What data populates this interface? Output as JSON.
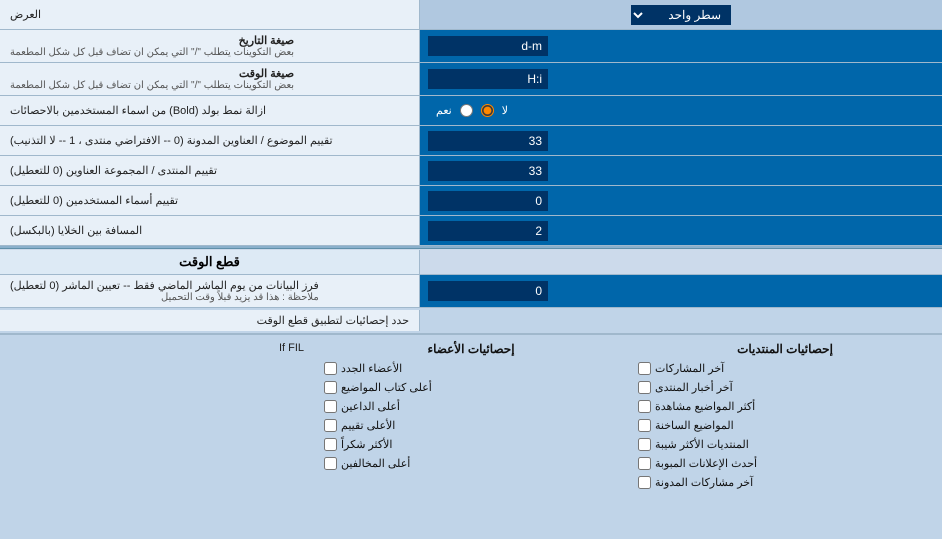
{
  "header": {
    "dropdown_label": "سطر واحد",
    "col_right_label": "العرض"
  },
  "date_format": {
    "label": "صيغة التاريخ",
    "sublabel": "بعض التكوينات يتطلب \"/\" التي يمكن ان تضاف قبل كل شكل المطعمة",
    "value": "d-m"
  },
  "time_format": {
    "label": "صيغة الوقت",
    "sublabel": "بعض التكوينات يتطلب \"/\" التي يمكن ان تضاف قبل كل شكل المطعمة",
    "value": "H:i"
  },
  "bold_remove": {
    "label": "ازالة نمط بولد (Bold) من اسماء المستخدمين بالاحصائات",
    "option_yes": "نعم",
    "option_no": "لا",
    "selected": "no"
  },
  "topic_sort": {
    "label": "تقييم الموضوع / العناوين المدونة (0 -- الافتراضي منتدى ، 1 -- لا التذنيب)",
    "value": "33"
  },
  "forum_sort": {
    "label": "تقييم المنتدى / المجموعة العناوين (0 للتعطيل)",
    "value": "33"
  },
  "user_sort": {
    "label": "تقييم أسماء المستخدمين (0 للتعطيل)",
    "value": "0"
  },
  "cell_spacing": {
    "label": "المسافة بين الخلايا (بالبكسل)",
    "value": "2"
  },
  "cutoff_section": {
    "title": "قطع الوقت"
  },
  "cutoff_filter": {
    "label": "فرز البيانات من يوم الماشر الماضي فقط -- تعيين الماشر (0 لتعطيل)",
    "note": "ملاحظة : هذا قد يزيد قبلاً وقت التحميل",
    "value": "0"
  },
  "stats_apply": {
    "label": "حدد إحصائيات لتطبيق قطع الوقت"
  },
  "checkboxes": {
    "col1_header": "إحصائيات المنتديات",
    "col2_header": "إحصائيات الأعضاء",
    "col1": [
      "آخر المشاركات",
      "آخر أخبار المنتدى",
      "أكثر المواضيع مشاهدة",
      "المواضيع الساخنة",
      "المنتديات الأكثر شيبة",
      "أحدث الإعلانات المبوبة",
      "آخر مشاركات المدونة"
    ],
    "col2": [
      "الأعضاء الجدد",
      "أعلى كتاب المواضيع",
      "أعلى الداعين",
      "الأعلى تقييم",
      "الأكثر شكراً",
      "أعلى المخالفين"
    ]
  },
  "apply_stats_label": "حدد إحصائيات لتطبيق قطع الوقت",
  "bottom_text": "If FIL"
}
